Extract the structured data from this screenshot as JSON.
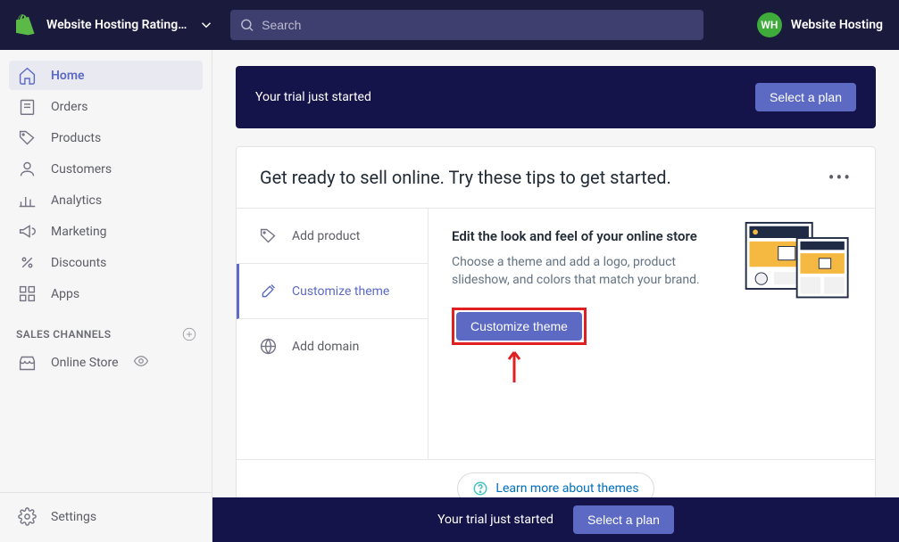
{
  "header": {
    "store_name": "Website Hosting Rating...",
    "search_placeholder": "Search",
    "user_initials": "WH",
    "user_name": "Website Hosting"
  },
  "sidebar": {
    "items": [
      {
        "label": "Home"
      },
      {
        "label": "Orders"
      },
      {
        "label": "Products"
      },
      {
        "label": "Customers"
      },
      {
        "label": "Analytics"
      },
      {
        "label": "Marketing"
      },
      {
        "label": "Discounts"
      },
      {
        "label": "Apps"
      }
    ],
    "channels_header": "SALES CHANNELS",
    "channels": [
      {
        "label": "Online Store"
      }
    ],
    "settings_label": "Settings"
  },
  "trial": {
    "message": "Your trial just started",
    "cta": "Select a plan"
  },
  "card": {
    "title": "Get ready to sell online. Try these tips to get started.",
    "steps": [
      {
        "label": "Add product"
      },
      {
        "label": "Customize theme"
      },
      {
        "label": "Add domain"
      }
    ],
    "content": {
      "title": "Edit the look and feel of your online store",
      "desc": "Choose a theme and add a logo, product slideshow, and colors that match your brand.",
      "cta": "Customize theme"
    },
    "learn_more": "Learn more about themes"
  },
  "footer": {
    "message": "Your trial just started",
    "cta": "Select a plan"
  }
}
